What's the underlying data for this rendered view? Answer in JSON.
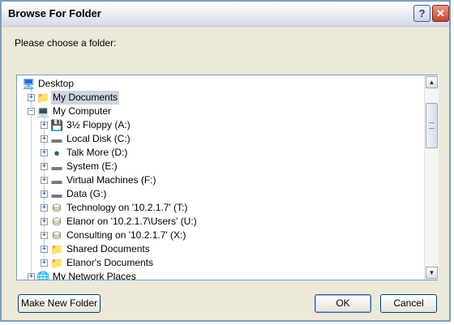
{
  "window": {
    "title": "Browse For Folder",
    "help_glyph": "?",
    "close_glyph": "✕"
  },
  "prompt": "Please choose a folder:",
  "tree": {
    "root": {
      "label": "Desktop",
      "icon": "desktop-icon"
    },
    "items": [
      {
        "label": "My Documents",
        "icon": "my-documents-icon",
        "expander": "+",
        "selected": true
      },
      {
        "label": "My Computer",
        "icon": "my-computer-icon",
        "expander": "−",
        "selected": false
      },
      {
        "label": "3½ Floppy (A:)",
        "icon": "floppy-drive-icon",
        "expander": "+"
      },
      {
        "label": "Local Disk (C:)",
        "icon": "hard-drive-icon",
        "expander": "+"
      },
      {
        "label": "Talk More (D:)",
        "icon": "cd-drive-icon",
        "expander": "+"
      },
      {
        "label": "System (E:)",
        "icon": "hard-drive-icon",
        "expander": "+"
      },
      {
        "label": "Virtual Machines (F:)",
        "icon": "hard-drive-icon",
        "expander": "+"
      },
      {
        "label": "Data (G:)",
        "icon": "hard-drive-icon",
        "expander": "+"
      },
      {
        "label": "Technology on '10.2.1.7' (T:)",
        "icon": "network-drive-icon",
        "expander": "+"
      },
      {
        "label": "Elanor on '10.2.1.7\\Users' (U:)",
        "icon": "network-drive-icon",
        "expander": "+"
      },
      {
        "label": "Consulting on '10.2.1.7' (X:)",
        "icon": "network-drive-icon",
        "expander": "+"
      },
      {
        "label": "Shared Documents",
        "icon": "folder-icon",
        "expander": "+"
      },
      {
        "label": "Elanor's Documents",
        "icon": "folder-icon",
        "expander": "+"
      },
      {
        "label": "My Network Places",
        "icon": "network-places-icon",
        "expander": "+"
      }
    ]
  },
  "scrollbar": {
    "up": "▲",
    "down": "▼"
  },
  "buttons": {
    "make_new_folder": "Make New Folder",
    "ok": "OK",
    "cancel": "Cancel"
  },
  "colors": {
    "dialog_bg": "#ece9d8",
    "selection": "#cdd6e2",
    "border": "#7f9db9"
  }
}
